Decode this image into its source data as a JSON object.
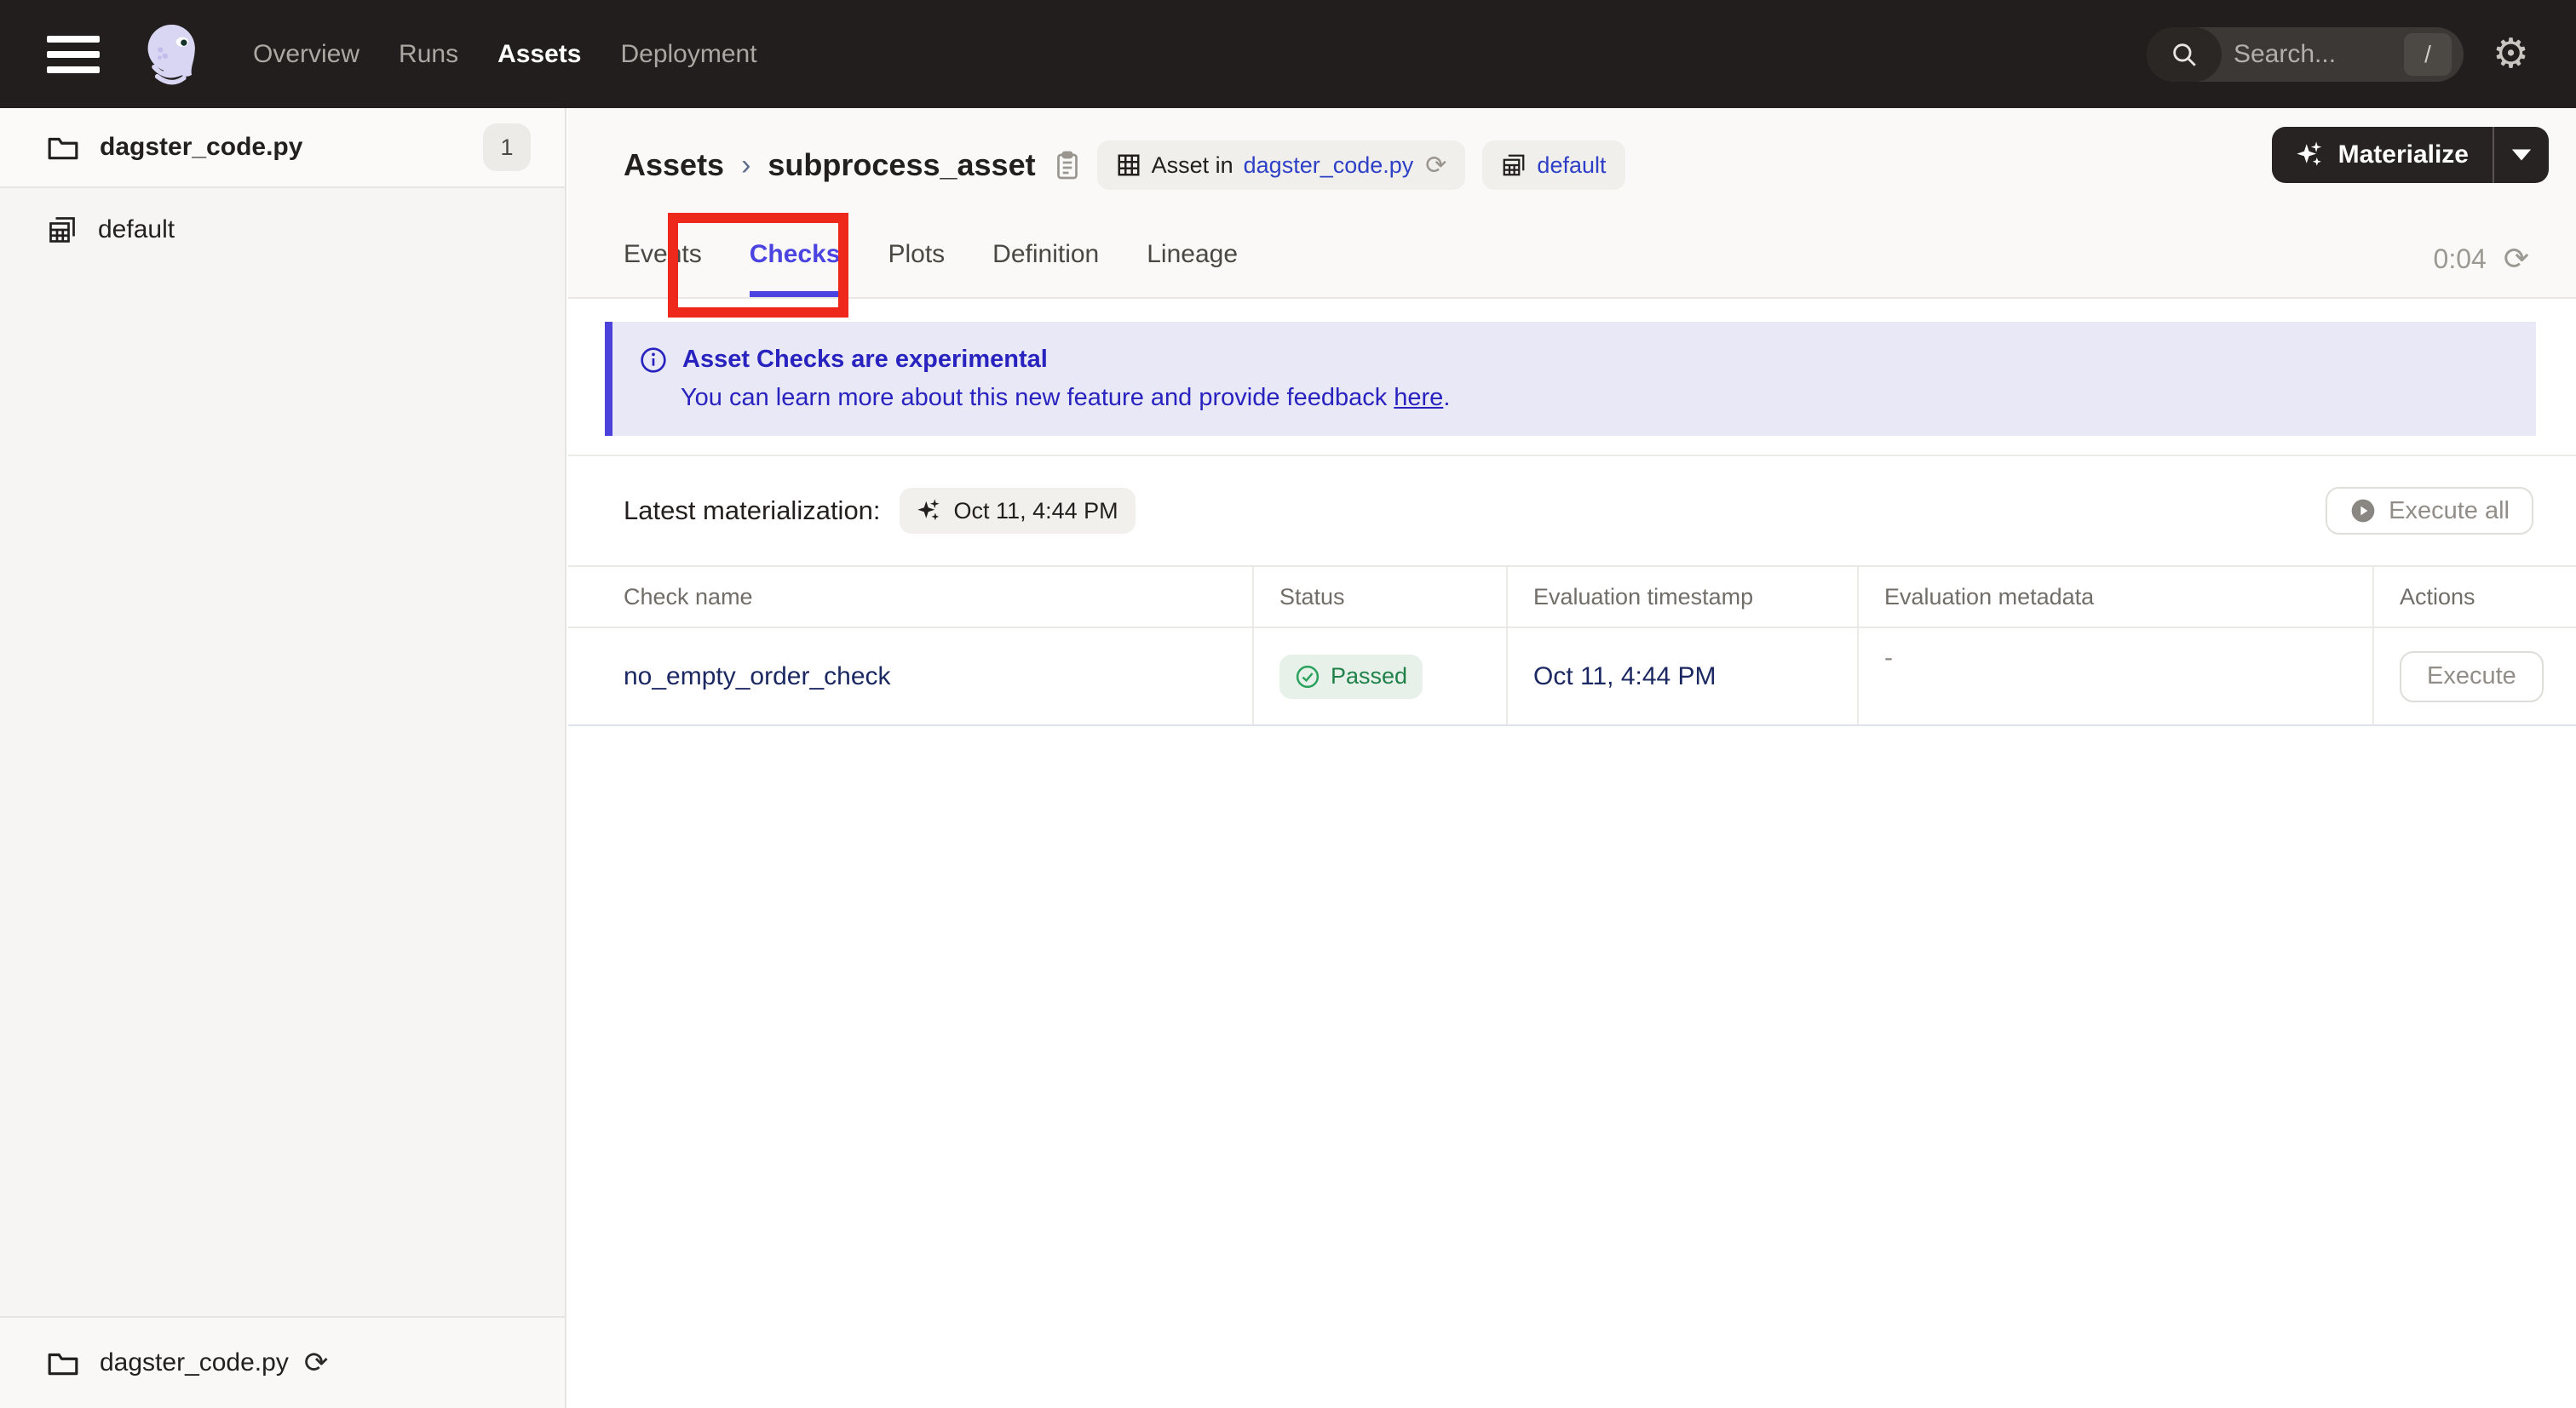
{
  "navbar": {
    "menu": [
      {
        "label": "Overview",
        "active": false
      },
      {
        "label": "Runs",
        "active": false
      },
      {
        "label": "Assets",
        "active": true
      },
      {
        "label": "Deployment",
        "active": false
      }
    ],
    "search": {
      "placeholder": "Search...",
      "shortcut": "/"
    }
  },
  "sidebar": {
    "items": [
      {
        "label": "dagster_code.py",
        "count": "1",
        "icon": "folder-icon"
      },
      {
        "label": "default",
        "icon": "asset-group-icon"
      }
    ],
    "footer": {
      "label": "dagster_code.py",
      "icon": "folder-icon"
    }
  },
  "header": {
    "breadcrumb": {
      "section": "Assets",
      "separator": "›",
      "asset": "subprocess_asset"
    },
    "asset_pill": {
      "prefix": "Asset in",
      "link": "dagster_code.py"
    },
    "group_pill": {
      "label": "default"
    },
    "materialize": {
      "label": "Materialize"
    }
  },
  "tabs": {
    "items": [
      "Events",
      "Checks",
      "Plots",
      "Definition",
      "Lineage"
    ],
    "active": "Checks",
    "refresh_time": "0:04"
  },
  "banner": {
    "title": "Asset Checks are experimental",
    "body": "You can learn more about this new feature and provide feedback ",
    "link": "here",
    "suffix": "."
  },
  "materialization": {
    "label": "Latest materialization:",
    "timestamp": "Oct 11, 4:44 PM",
    "execute_all": "Execute all"
  },
  "table": {
    "columns": [
      "Check name",
      "Status",
      "Evaluation timestamp",
      "Evaluation metadata",
      "Actions"
    ],
    "rows": [
      {
        "name": "no_empty_order_check",
        "status": "Passed",
        "timestamp": "Oct 11, 4:44 PM",
        "metadata": "-",
        "action": "Execute"
      }
    ]
  },
  "colors": {
    "accent_indigo": "#4d41db",
    "active_tab": "#4b44e0",
    "banner_bg": "#e9e8f6",
    "banner_text": "#2823bf",
    "annotation_red": "#ee281a",
    "success_green": "#1f8048",
    "success_bg": "#e7f1ea",
    "link_navy": "#1b2862",
    "pill_link_blue": "#2e41c6",
    "navbar_bg": "#221e1d"
  }
}
